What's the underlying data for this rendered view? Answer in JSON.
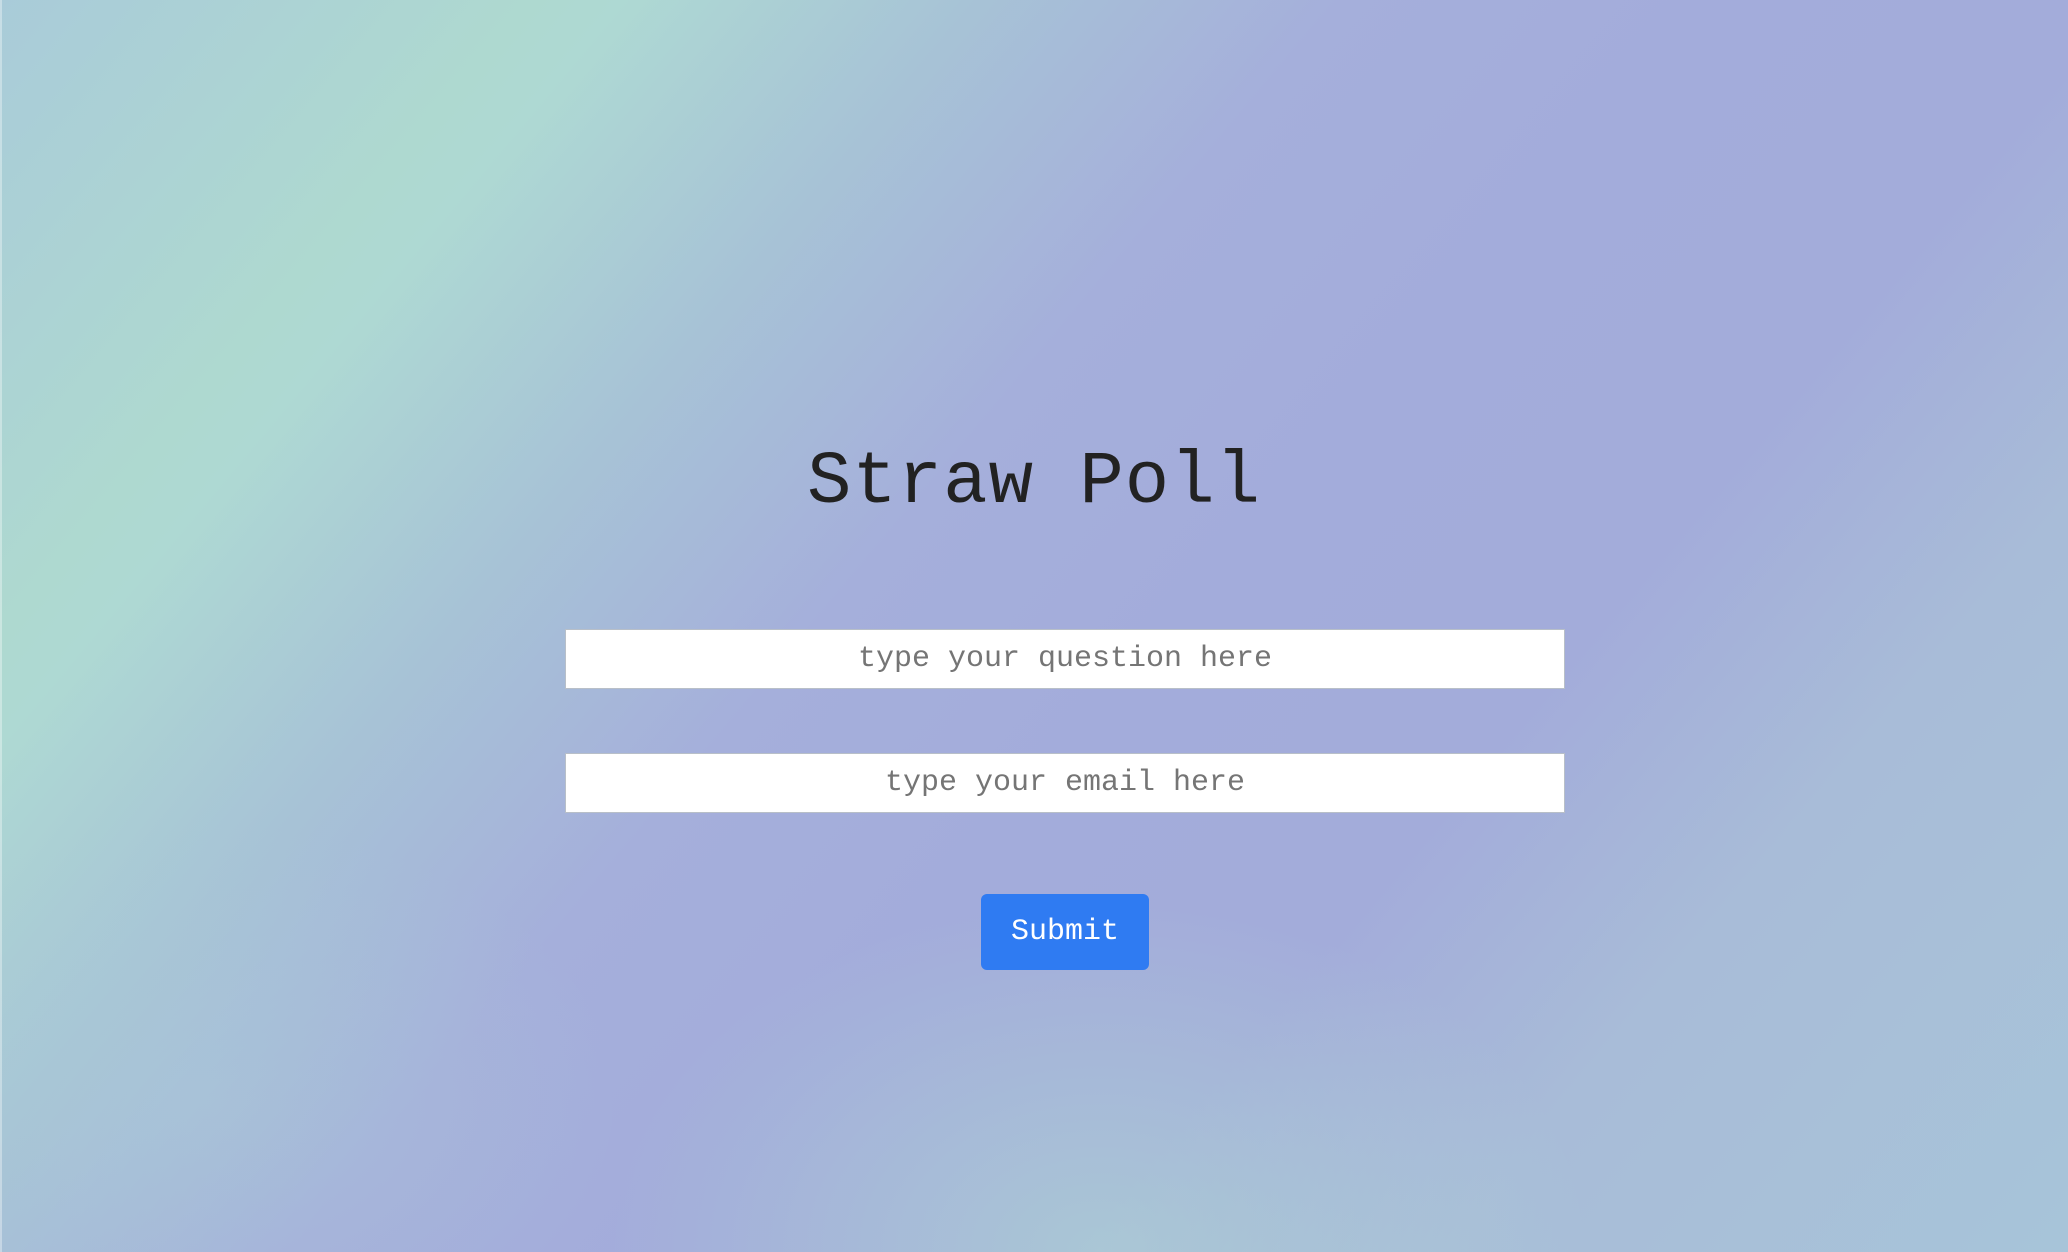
{
  "page": {
    "title": "Straw Poll"
  },
  "form": {
    "question_placeholder": "type your question here",
    "email_placeholder": "type your email here",
    "submit_label": "Submit"
  },
  "colors": {
    "accent": "#2f7bf2",
    "title_text": "#222222",
    "background_start": "#aed9d0",
    "background_mid": "#a3acdb"
  }
}
